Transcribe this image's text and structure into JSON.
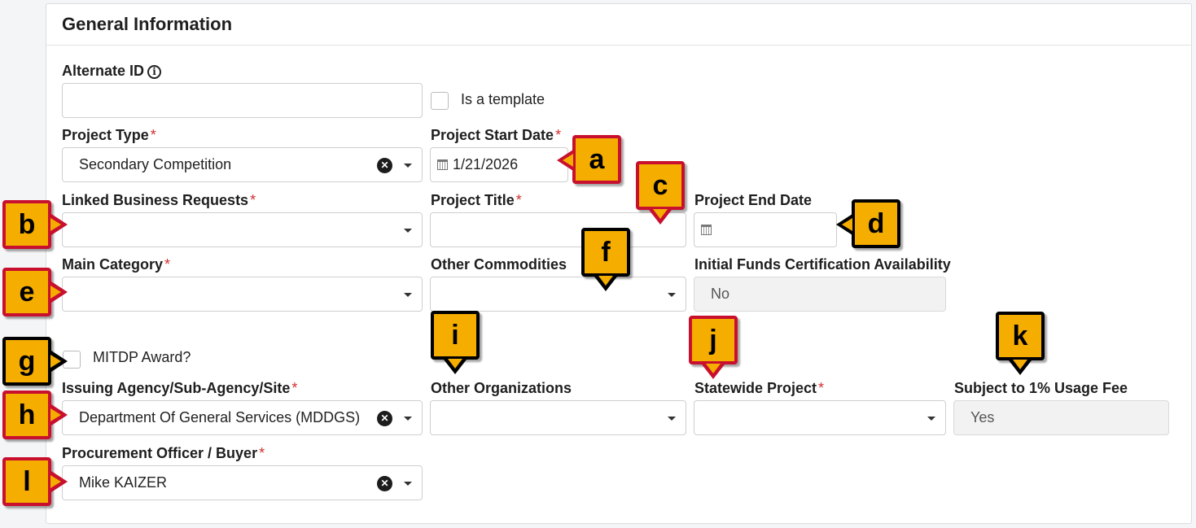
{
  "section": {
    "title": "General Information"
  },
  "alternate_id": {
    "label": "Alternate ID",
    "value": ""
  },
  "is_template": {
    "label": "Is a template",
    "checked": false
  },
  "project_type": {
    "label": "Project Type",
    "required_mark": "*",
    "value": "Secondary Competition"
  },
  "project_start_date": {
    "label": "Project Start Date",
    "required_mark": "*",
    "value": "1/21/2026"
  },
  "linked_business_requests": {
    "label": "Linked Business Requests",
    "required_mark": "*",
    "value": ""
  },
  "project_title": {
    "label": "Project Title",
    "required_mark": "*",
    "value": ""
  },
  "project_end_date": {
    "label": "Project End Date",
    "value": ""
  },
  "main_category": {
    "label": "Main Category",
    "required_mark": "*",
    "value": ""
  },
  "other_commodities": {
    "label": "Other Commodities",
    "value": ""
  },
  "initial_funds": {
    "label": "Initial Funds Certification Availability",
    "value": "No"
  },
  "mitdp_award": {
    "label": "MITDP Award?",
    "checked": false
  },
  "issuing_agency": {
    "label": "Issuing Agency/Sub-Agency/Site",
    "required_mark": "*",
    "value": "Department Of General Services (MDDGS)"
  },
  "other_organizations": {
    "label": "Other Organizations",
    "value": ""
  },
  "statewide_project": {
    "label": "Statewide Project",
    "required_mark": "*",
    "value": ""
  },
  "usage_fee": {
    "label": "Subject to 1% Usage Fee",
    "value": "Yes"
  },
  "procurement_officer": {
    "label": "Procurement Officer / Buyer",
    "required_mark": "*",
    "value": "Mike KAIZER"
  },
  "callouts": {
    "a": "a",
    "b": "b",
    "c": "c",
    "d": "d",
    "e": "e",
    "f": "f",
    "g": "g",
    "h": "h",
    "i": "i",
    "j": "j",
    "k": "k",
    "l": "l"
  },
  "colors": {
    "callout_fill": "#f5ad00",
    "callout_border_black": "#000000",
    "callout_border_red": "#c8102e",
    "required": "#d32f2f"
  },
  "icons": {
    "info": "info-circle-icon",
    "clear": "clear-x-icon",
    "dropdown": "chevron-down-icon",
    "calendar": "calendar-icon"
  }
}
